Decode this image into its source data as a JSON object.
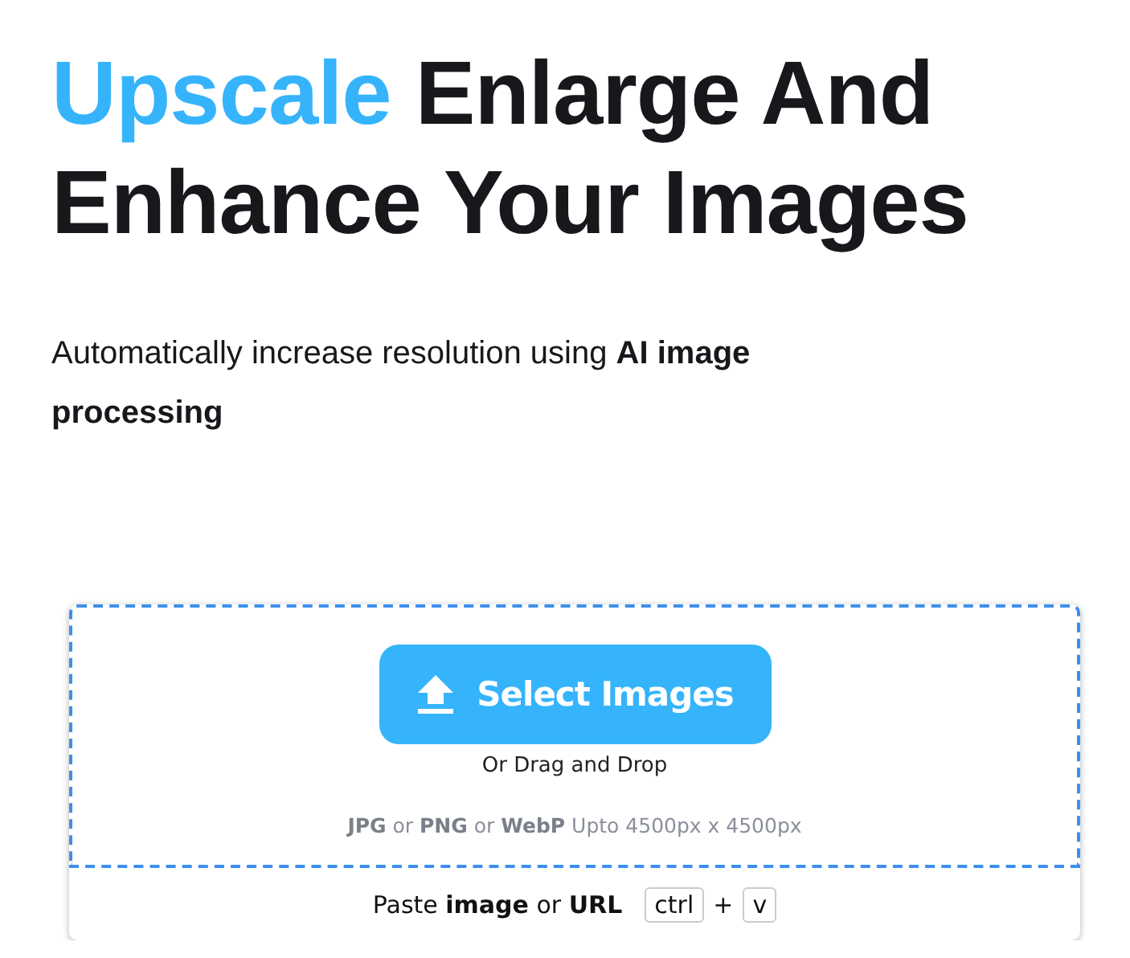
{
  "heading": {
    "highlight": "Upscale",
    "rest": "Enlarge And Enhance Your Images"
  },
  "subtitle": "Automatically increase resolution using **AI image processing**",
  "uploader": {
    "button": "Select Images",
    "drag_hint": "Or Drag and Drop",
    "formats": "**JPG** or **PNG** or **WebP** Upto 4500px x 4500px",
    "paste_hint": "Paste **image** or **URL**",
    "shortcut": [
      {
        "key": "ctrl"
      },
      {
        "key": "v"
      }
    ],
    "shortcut_joiner": "+"
  }
}
